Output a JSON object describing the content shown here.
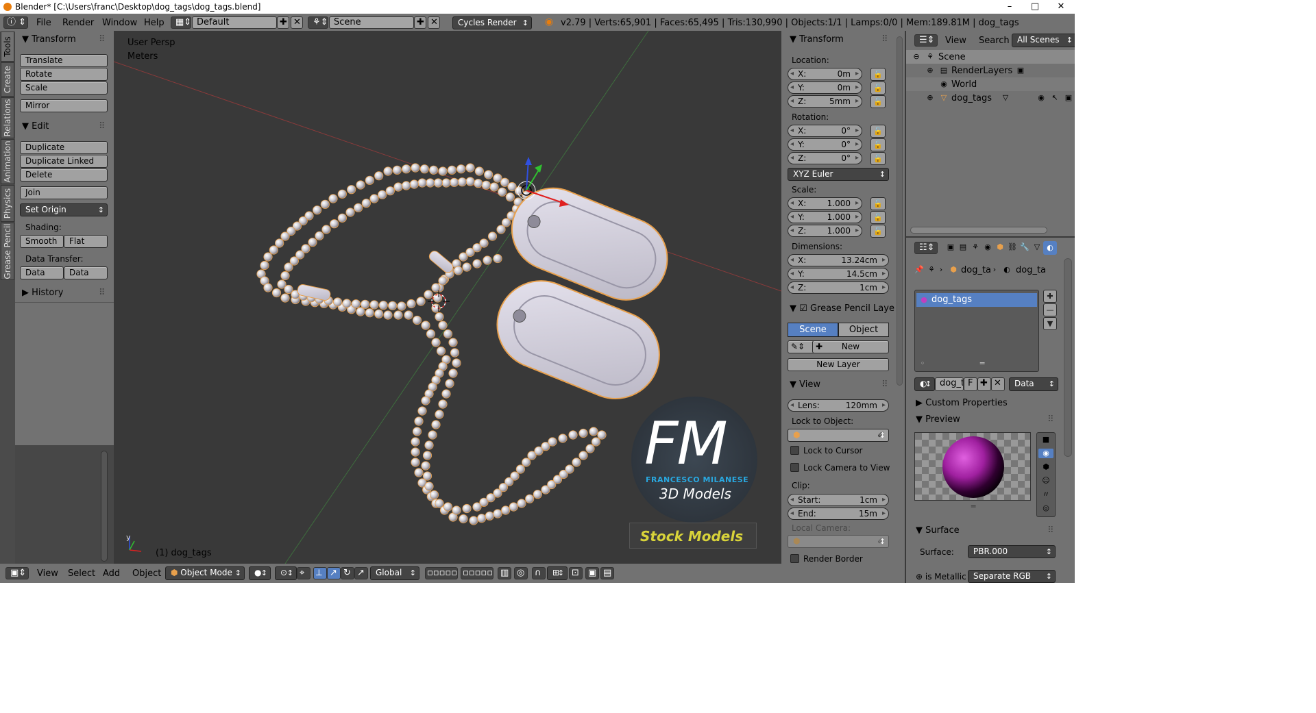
{
  "window": {
    "title": "Blender* [C:\\Users\\franc\\Desktop\\dog_tags\\dog_tags.blend]",
    "min": "–",
    "max": "□",
    "close": "✕"
  },
  "info_header": {
    "menus": [
      "File",
      "Render",
      "Window",
      "Help"
    ],
    "layout": "Default",
    "scene": "Scene",
    "engine": "Cycles Render",
    "stats": "v2.79 | Verts:65,901 | Faces:65,495 | Tris:130,990 | Objects:1/1 | Lamps:0/0 | Mem:189.81M | dog_tags"
  },
  "tool_tabs": [
    "Tools",
    "Create",
    "Relations",
    "Animation",
    "Physics",
    "Grease Pencil"
  ],
  "tool_shelf": {
    "transform_title": "Transform",
    "translate": "Translate",
    "rotate": "Rotate",
    "scale": "Scale",
    "mirror": "Mirror",
    "edit_title": "Edit",
    "duplicate": "Duplicate",
    "duplicate_linked": "Duplicate Linked",
    "delete": "Delete",
    "join": "Join",
    "set_origin": "Set Origin",
    "shading_label": "Shading:",
    "smooth": "Smooth",
    "flat": "Flat",
    "data_transfer_label": "Data Transfer:",
    "data": "Data",
    "data_layout": "Data Layo",
    "history": "History"
  },
  "viewport": {
    "view_name": "User Persp",
    "units": "Meters",
    "object_label": "(1) dog_tags",
    "logo_letters": "FM",
    "logo_name": "FRANCESCO MILANESE",
    "logo_sub": "3D Models",
    "stock_label": "Stock Models"
  },
  "properties_n": {
    "transform_title": "Transform",
    "location_label": "Location:",
    "location": {
      "x": "0m",
      "y": "0m",
      "z": "5mm"
    },
    "rotation_label": "Rotation:",
    "rotation": {
      "x": "0°",
      "y": "0°",
      "z": "0°"
    },
    "rotation_mode": "XYZ Euler",
    "scale_label": "Scale:",
    "scale": {
      "x": "1.000",
      "y": "1.000",
      "z": "1.000"
    },
    "dimensions_label": "Dimensions:",
    "dimensions": {
      "x": "13.24cm",
      "y": "14.5cm",
      "z": "1cm"
    },
    "axis_x": "X:",
    "axis_y": "Y:",
    "axis_z": "Z:",
    "grease_title": "Grease Pencil Layer",
    "gp_scene": "Scene",
    "gp_object": "Object",
    "gp_new": "New",
    "gp_new_layer": "New Layer",
    "view_title": "View",
    "lens_label": "Lens:",
    "lens": "120mm",
    "lock_object_label": "Lock to Object:",
    "lock_cursor": "Lock to Cursor",
    "lock_camera": "Lock Camera to View",
    "clip_label": "Clip:",
    "clip_start_label": "Start:",
    "clip_start": "1cm",
    "clip_end_label": "End:",
    "clip_end": "15m",
    "local_camera": "Local Camera:",
    "render_border": "Render Border"
  },
  "outliner": {
    "menus": [
      "View",
      "Search"
    ],
    "filter": "All Scenes",
    "scene": "Scene",
    "render_layers": "RenderLayers",
    "world": "World",
    "object": "dog_tags"
  },
  "properties": {
    "breadcrumb_obj": "dog_ta",
    "breadcrumb_mat": "dog_ta",
    "slot": "dog_tags",
    "mat_field": "dog_t",
    "fake_user": "F",
    "link_mode": "Data",
    "custom_props": "Custom Properties",
    "preview_title": "Preview",
    "surface_title": "Surface",
    "surface_label": "Surface:",
    "surface_value": "PBR.000",
    "is_metallic": "is Metallic",
    "separate_rgb": "Separate RGB"
  },
  "bottom_header": {
    "menus": [
      "View",
      "Select",
      "Add",
      "Object"
    ],
    "mode": "Object Mode",
    "orientation": "Global"
  },
  "colors": {
    "selected_blue": "#5680c2",
    "orange_outline": "#e8a04c",
    "logo_blue": "#29a8e0",
    "stock_yellow": "#d8d33a"
  }
}
